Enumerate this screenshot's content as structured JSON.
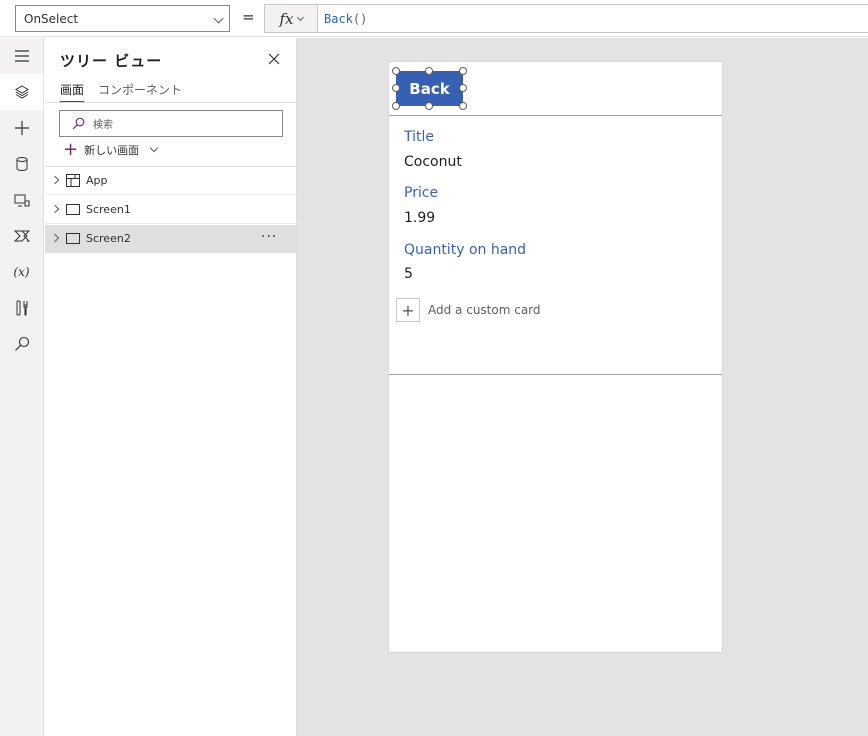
{
  "formula_bar": {
    "property": "OnSelect",
    "equals": "=",
    "fx_label": "fx",
    "formula_function": "Back",
    "formula_parens": "()"
  },
  "rail": {
    "items": [
      {
        "name": "menu-icon",
        "active": false
      },
      {
        "name": "tree-view-icon",
        "active": true
      },
      {
        "name": "insert-icon",
        "active": false
      },
      {
        "name": "data-icon",
        "active": false
      },
      {
        "name": "media-icon",
        "active": false
      },
      {
        "name": "power-automate-icon",
        "active": false
      },
      {
        "name": "variables-icon",
        "active": false
      },
      {
        "name": "advanced-tools-icon",
        "active": false
      },
      {
        "name": "search-icon",
        "active": false
      }
    ],
    "variables_label": "(x)"
  },
  "tree_view": {
    "title": "ツリー ビュー",
    "tabs": [
      {
        "label": "画面",
        "selected": true
      },
      {
        "label": "コンポーネント",
        "selected": false
      }
    ],
    "search_placeholder": "検索",
    "new_screen_label": "新しい画面",
    "nodes": [
      {
        "label": "App",
        "icon": "app-icon",
        "selected": false
      },
      {
        "label": "Screen1",
        "icon": "screen-icon",
        "selected": false
      },
      {
        "label": "Screen2",
        "icon": "screen-icon",
        "selected": true
      }
    ],
    "more_label": "···"
  },
  "canvas": {
    "back_button_label": "Back",
    "fields": [
      {
        "label": "Title",
        "value": "Coconut"
      },
      {
        "label": "Price",
        "value": "1.99"
      },
      {
        "label": "Quantity on hand",
        "value": "5"
      }
    ],
    "add_card_label": "Add a custom card"
  },
  "colors": {
    "accent_purple": "#742774",
    "button_blue": "#3860b2",
    "field_label_blue": "#3860b2",
    "canvas_background": "#e3e3e3"
  }
}
